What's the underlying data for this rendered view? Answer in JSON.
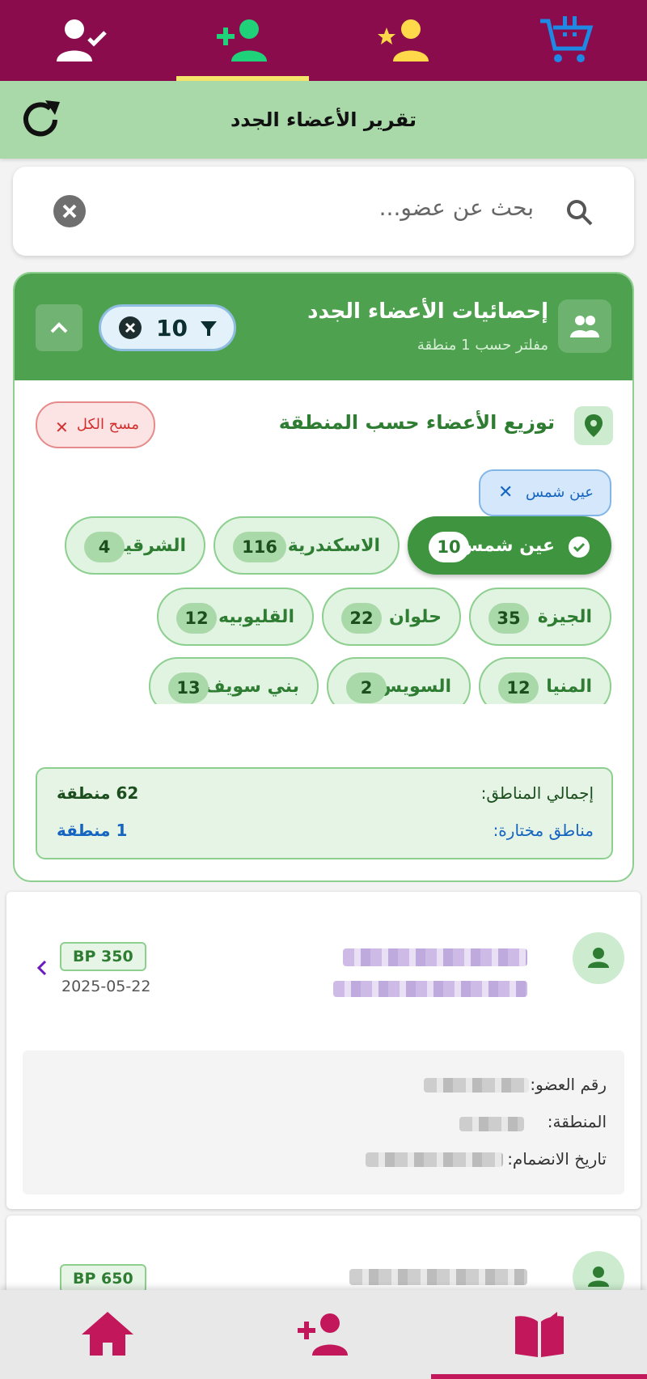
{
  "top_tabs": [
    {
      "icon": "person-check-icon",
      "active": false
    },
    {
      "icon": "person-add-icon",
      "active": true
    },
    {
      "icon": "person-star-icon",
      "active": false
    },
    {
      "icon": "cart-icon",
      "active": false
    }
  ],
  "header": {
    "title": "تقرير الأعضاء الجدد",
    "refresh_icon": "refresh-icon"
  },
  "search": {
    "placeholder": "بحث عن عضو..."
  },
  "stats": {
    "title": "إحصائيات الأعضاء الجدد",
    "subtitle": "مفلتر حسب 1 منطقة",
    "filter_count": "10",
    "distribution_title": "توزيع الأعضاء حسب المنطقة",
    "clear_all": "مسح الكل",
    "selected_chip": "عين شمس",
    "regions": [
      {
        "name": "عين شمس",
        "count": "10",
        "selected": true
      },
      {
        "name": "الاسكندرية",
        "count": "116",
        "selected": false
      },
      {
        "name": "الشرقية",
        "count": "4",
        "selected": false
      },
      {
        "name": "الجيزة",
        "count": "35",
        "selected": false
      },
      {
        "name": "حلوان",
        "count": "22",
        "selected": false
      },
      {
        "name": "القليوبيه",
        "count": "12",
        "selected": false
      },
      {
        "name": "المنيا",
        "count": "12",
        "selected": false
      },
      {
        "name": "السويس",
        "count": "2",
        "selected": false
      },
      {
        "name": "بني سويف",
        "count": "13",
        "selected": false
      }
    ],
    "summary": {
      "total_label": "إجمالي المناطق:",
      "total_value": "62 منطقة",
      "selected_label": "مناطق مختارة:",
      "selected_value": "1 منطقة"
    }
  },
  "members": [
    {
      "bp": "BP 350",
      "date": "2025-05-22",
      "labels": [
        "رقم العضو:",
        "المنطقة:",
        "تاريخ الانضمام:"
      ]
    },
    {
      "bp": "BP 650"
    }
  ],
  "colors": {
    "primary": "#8a0c4c",
    "green": "#4ea14f",
    "accent": "#c2185b"
  },
  "bottom_nav": [
    {
      "icon": "home-icon",
      "active": false
    },
    {
      "icon": "person-add-icon",
      "active": false
    },
    {
      "icon": "book-icon",
      "active": true
    }
  ]
}
